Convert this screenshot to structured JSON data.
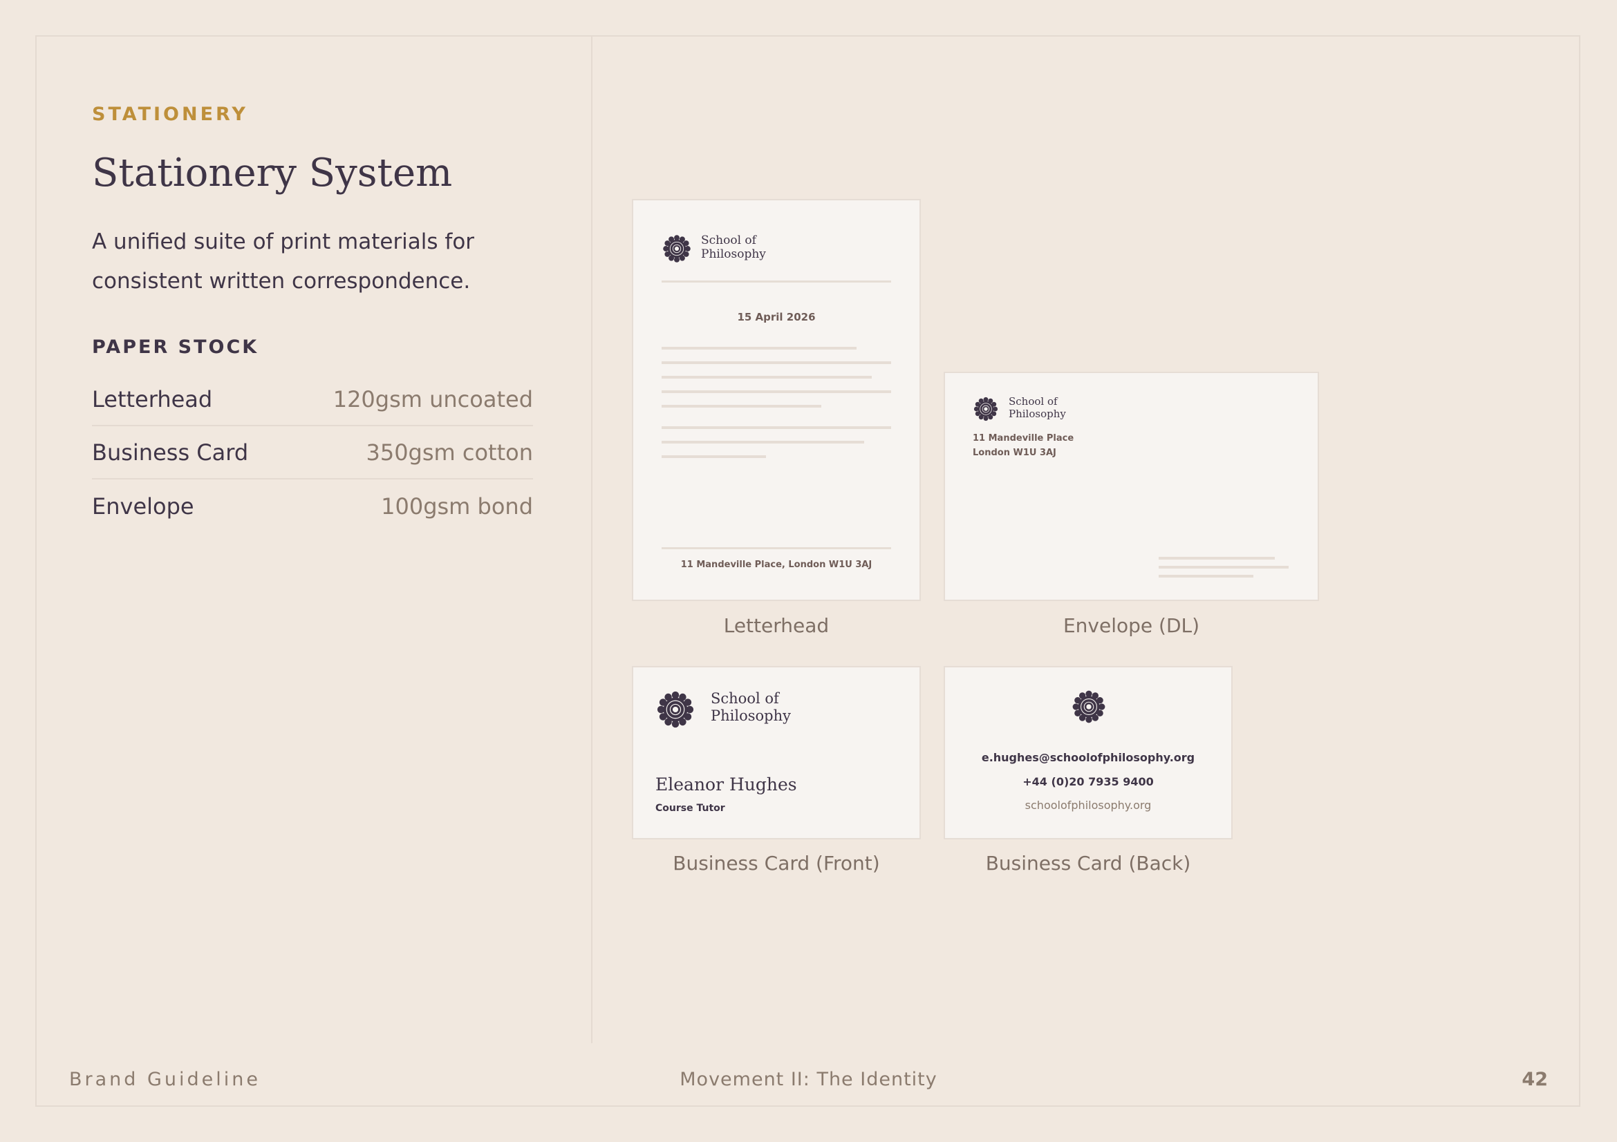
{
  "section": {
    "eyebrow": "STATIONERY",
    "title": "Stationery System",
    "description": "A unified suite of print materials for consistent written correspondence."
  },
  "paper_stock": {
    "heading": "PAPER STOCK",
    "items": [
      {
        "name": "Letterhead",
        "value": "120gsm uncoated"
      },
      {
        "name": "Business Card",
        "value": "350gsm cotton"
      },
      {
        "name": "Envelope",
        "value": "100gsm bond"
      }
    ]
  },
  "brand": {
    "name_line1": "School of",
    "name_line2": "Philosophy",
    "address": "11 Mandeville Place, London W1U 3AJ",
    "address_line1": "11 Mandeville Place",
    "address_line2": "London W1U 3AJ"
  },
  "letterhead": {
    "date": "15 April 2026",
    "caption": "Letterhead"
  },
  "envelope": {
    "caption": "Envelope (DL)"
  },
  "business_card_front": {
    "person_name": "Eleanor Hughes",
    "role": "Course Tutor",
    "caption": "Business Card (Front)"
  },
  "business_card_back": {
    "email": "e.hughes@schoolofphilosophy.org",
    "phone": "+44 (0)20 7935 9400",
    "website": "schoolofphilosophy.org",
    "caption": "Business Card (Back)"
  },
  "footer": {
    "left": "Brand Guideline",
    "center": "Movement II: The Identity",
    "page_number": "42"
  },
  "colors": {
    "background": "#f1e8df",
    "accent_gold": "#be8f3a",
    "ink": "#3f3547",
    "muted": "#8b7b6e",
    "paper": "#f7f4f1"
  },
  "icons": {
    "logo": "rosette-mark-icon"
  }
}
